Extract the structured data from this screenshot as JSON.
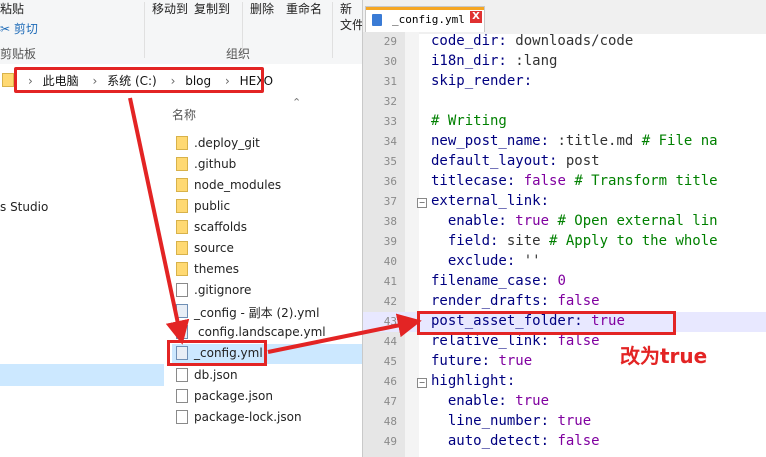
{
  "ribbon": {
    "paste": "粘贴",
    "cut": "剪切",
    "clipboard_group": "剪贴板",
    "move_to": "移动到",
    "copy_to": "复制到",
    "delete": "删除",
    "rename": "重命名",
    "new_partial": "新",
    "file_partial": "文件",
    "organize_group": "组织"
  },
  "address": {
    "crumbs": [
      "此电脑",
      "系统 (C:)",
      "blog",
      "HEXO"
    ]
  },
  "nav": {
    "item": "s Studio"
  },
  "files": {
    "column_header": "名称",
    "items": [
      ".deploy_git",
      ".github",
      "node_modules",
      "public",
      "scaffolds",
      "source",
      "themes",
      ".gitignore",
      "_config - 副本 (2).yml",
      "config.landscape.yml",
      "_config.yml",
      "db.json",
      "package.json",
      "package-lock.json"
    ]
  },
  "editor": {
    "tab_label": "_config.yml",
    "tab_close": "X",
    "lines": [
      {
        "n": "29",
        "key": "code_dir:",
        "val": " downloads/code",
        "bool": "",
        "comment": ""
      },
      {
        "n": "30",
        "key": "i18n_dir:",
        "val": " :lang",
        "bool": "",
        "comment": ""
      },
      {
        "n": "31",
        "key": "skip_render:",
        "val": "",
        "bool": "",
        "comment": ""
      },
      {
        "n": "32",
        "key": "",
        "val": "",
        "bool": "",
        "comment": ""
      },
      {
        "n": "33",
        "key": "",
        "val": "",
        "bool": "",
        "comment": "# Writing"
      },
      {
        "n": "34",
        "key": "new_post_name:",
        "val": " :title.md ",
        "bool": "",
        "comment": "# File na"
      },
      {
        "n": "35",
        "key": "default_layout:",
        "val": " post",
        "bool": "",
        "comment": ""
      },
      {
        "n": "36",
        "key": "titlecase:",
        "val": " ",
        "bool": "false",
        "comment": " # Transform title"
      },
      {
        "n": "37",
        "key": "external_link:",
        "val": "",
        "bool": "",
        "comment": ""
      },
      {
        "n": "38",
        "key": "  enable:",
        "val": " ",
        "bool": "true",
        "comment": " # Open external lin"
      },
      {
        "n": "39",
        "key": "  field:",
        "val": " site ",
        "bool": "",
        "comment": "# Apply to the whole"
      },
      {
        "n": "40",
        "key": "  exclude:",
        "val": " ''",
        "bool": "",
        "comment": ""
      },
      {
        "n": "41",
        "key": "filename_case:",
        "val": " ",
        "bool": "0",
        "comment": ""
      },
      {
        "n": "42",
        "key": "render_drafts:",
        "val": " ",
        "bool": "false",
        "comment": ""
      },
      {
        "n": "43",
        "key": "post_asset_folder:",
        "val": " ",
        "bool": "true",
        "comment": ""
      },
      {
        "n": "44",
        "key": "relative_link:",
        "val": " ",
        "bool": "false",
        "comment": ""
      },
      {
        "n": "45",
        "key": "future:",
        "val": " ",
        "bool": "true",
        "comment": ""
      },
      {
        "n": "46",
        "key": "highlight:",
        "val": "",
        "bool": "",
        "comment": ""
      },
      {
        "n": "47",
        "key": "  enable:",
        "val": " ",
        "bool": "true",
        "comment": ""
      },
      {
        "n": "48",
        "key": "  line_number:",
        "val": " ",
        "bool": "true",
        "comment": ""
      },
      {
        "n": "49",
        "key": "  auto_detect:",
        "val": " ",
        "bool": "false",
        "comment": ""
      }
    ]
  },
  "annotation": {
    "note": "改为true"
  }
}
